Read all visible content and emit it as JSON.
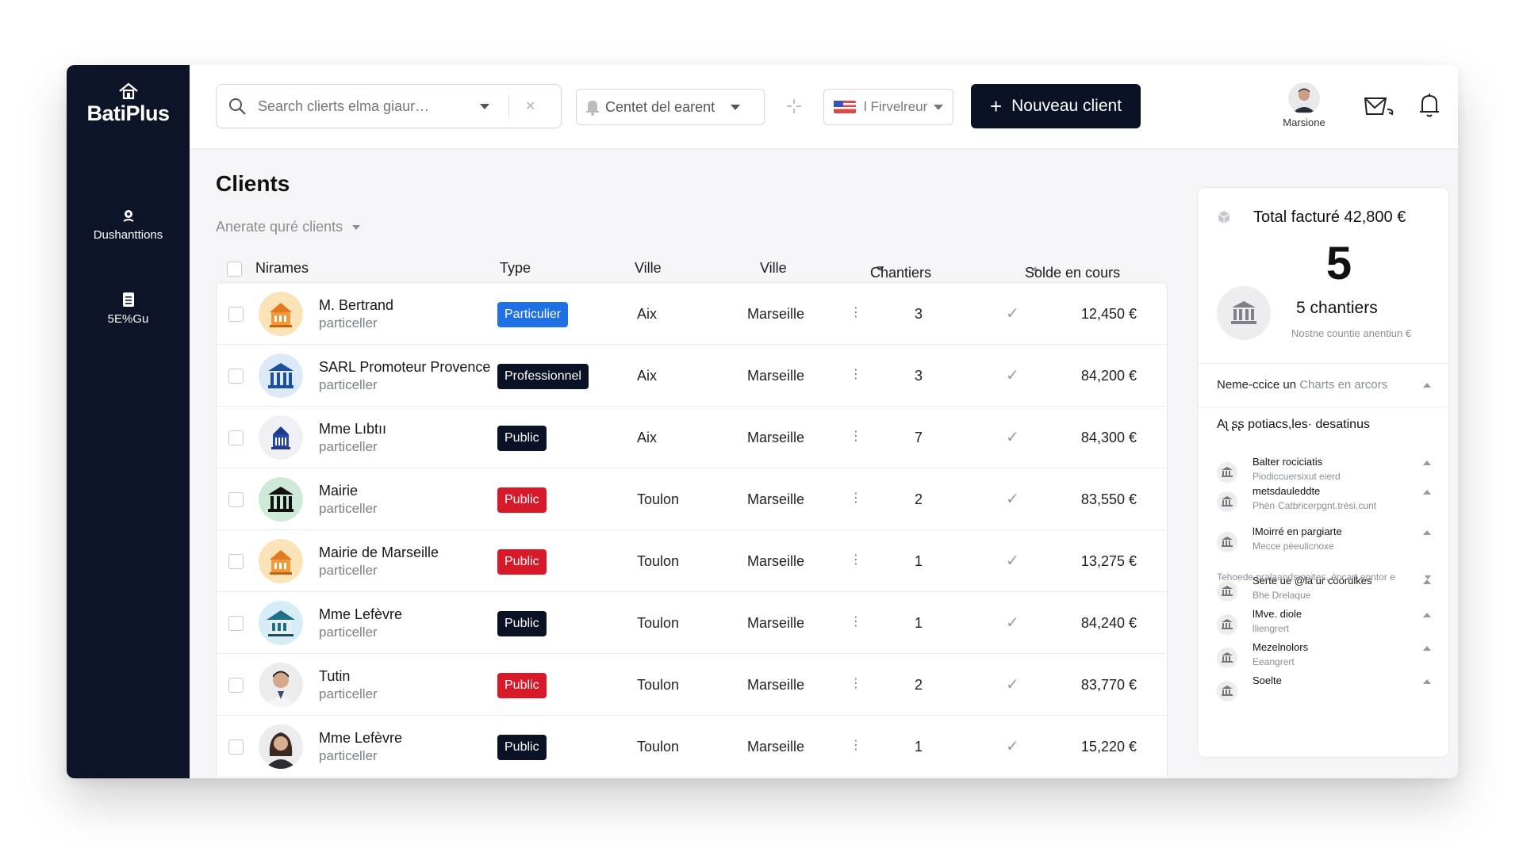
{
  "app": {
    "brand": "BatiPlus",
    "nav": [
      {
        "label": "Dushanttions",
        "icon": "location-icon"
      },
      {
        "label": "5E%Gu",
        "icon": "document-icon"
      }
    ]
  },
  "topbar": {
    "search_placeholder": "Search clierts elma giaur…",
    "filter_context": "Centet del earent",
    "filter_favorite": "l Firvelreur",
    "new_client_label": "Nouveau client",
    "user_name": "Marsione"
  },
  "page": {
    "title": "Clients",
    "subfilter": "Anerate quré clients"
  },
  "table": {
    "headers": {
      "name": "Nirames",
      "type": "Type",
      "city1": "Ville",
      "city2": "Ville",
      "sites": "Chantiers",
      "balance": "Solde en cours"
    },
    "rows": [
      {
        "name": "M. Bertrand",
        "sub": "particeller",
        "type": "Particulier",
        "type_color": "#1f6fe5",
        "avatar": "house-orange",
        "city1": "Aix",
        "city2": "Marseille",
        "count": "3",
        "amount": "12,450 €"
      },
      {
        "name": "SARL Promoteur Provence",
        "sub": "particeller",
        "type": "Professionnel",
        "type_color": "#0b1226",
        "avatar": "bank-blue",
        "city1": "Aix",
        "city2": "Marseille",
        "count": "3",
        "amount": "84,200 €"
      },
      {
        "name": "Mme Lıbtıı",
        "sub": "particeller",
        "type": "Public",
        "type_color": "#0b1226",
        "avatar": "bank-white",
        "city1": "Aix",
        "city2": "Marseille",
        "count": "7",
        "amount": "84,300 €"
      },
      {
        "name": "Mairie",
        "sub": "particeller",
        "type": "Public",
        "type_color": "#d8192a",
        "avatar": "bank-green",
        "city1": "Toulon",
        "city2": "Marseille",
        "count": "2",
        "amount": "83,550 €"
      },
      {
        "name": "Mairie de Marseille",
        "sub": "particeller",
        "type": "Public",
        "type_color": "#d8192a",
        "avatar": "house-orange",
        "city1": "Toulon",
        "city2": "Marseille",
        "count": "1",
        "amount": "13,275 €"
      },
      {
        "name": "Mme Lefèvre",
        "sub": "particeller",
        "type": "Public",
        "type_color": "#0b1226",
        "avatar": "building-blue",
        "city1": "Toulon",
        "city2": "Marseille",
        "count": "1",
        "amount": "84,240 €"
      },
      {
        "name": "Tutin",
        "sub": "particeller",
        "type": "Public",
        "type_color": "#d8192a",
        "avatar": "person-man",
        "city1": "Toulon",
        "city2": "Marseille",
        "count": "2",
        "amount": "83,770 €"
      },
      {
        "name": "Mme Lefèvre",
        "sub": "particeller",
        "type": "Public",
        "type_color": "#0b1226",
        "avatar": "person-woman",
        "city1": "Toulon",
        "city2": "Marseille",
        "count": "1",
        "amount": "15,220 €"
      }
    ]
  },
  "summary": {
    "total": "Total facturé 42,800 €",
    "big_number": "5",
    "chantiers": "5 chantiers",
    "note": "Nostne countie anentiun €",
    "section_label": "Neme-ccice un",
    "section_muted": "Charts en arcors",
    "heading": "Aʅ ʂʂ potiacs,les· desatinus",
    "projects": [
      {
        "title": "Balter rociciatis",
        "sub": "Piodiccuersixut eierd"
      },
      {
        "title": "metsdauleddte",
        "sub": "Phén·Catbricerpgnt.trėsi.cunt"
      },
      {
        "title": "lMoirré en pargiarte",
        "sub": "Mecce pėeulicnoxe"
      },
      {
        "title": "Serte ue @la ur coorulkes",
        "sub": "Bhe Drelaque"
      },
      {
        "title": "lMve. diole",
        "sub": "lliengrert"
      },
      {
        "title": "Mezelnolors",
        "sub": "Eeangrert"
      },
      {
        "title": "Soelte",
        "sub": ""
      }
    ],
    "note2": "Tehoede pralaandsınaites, épcart enntor e"
  }
}
